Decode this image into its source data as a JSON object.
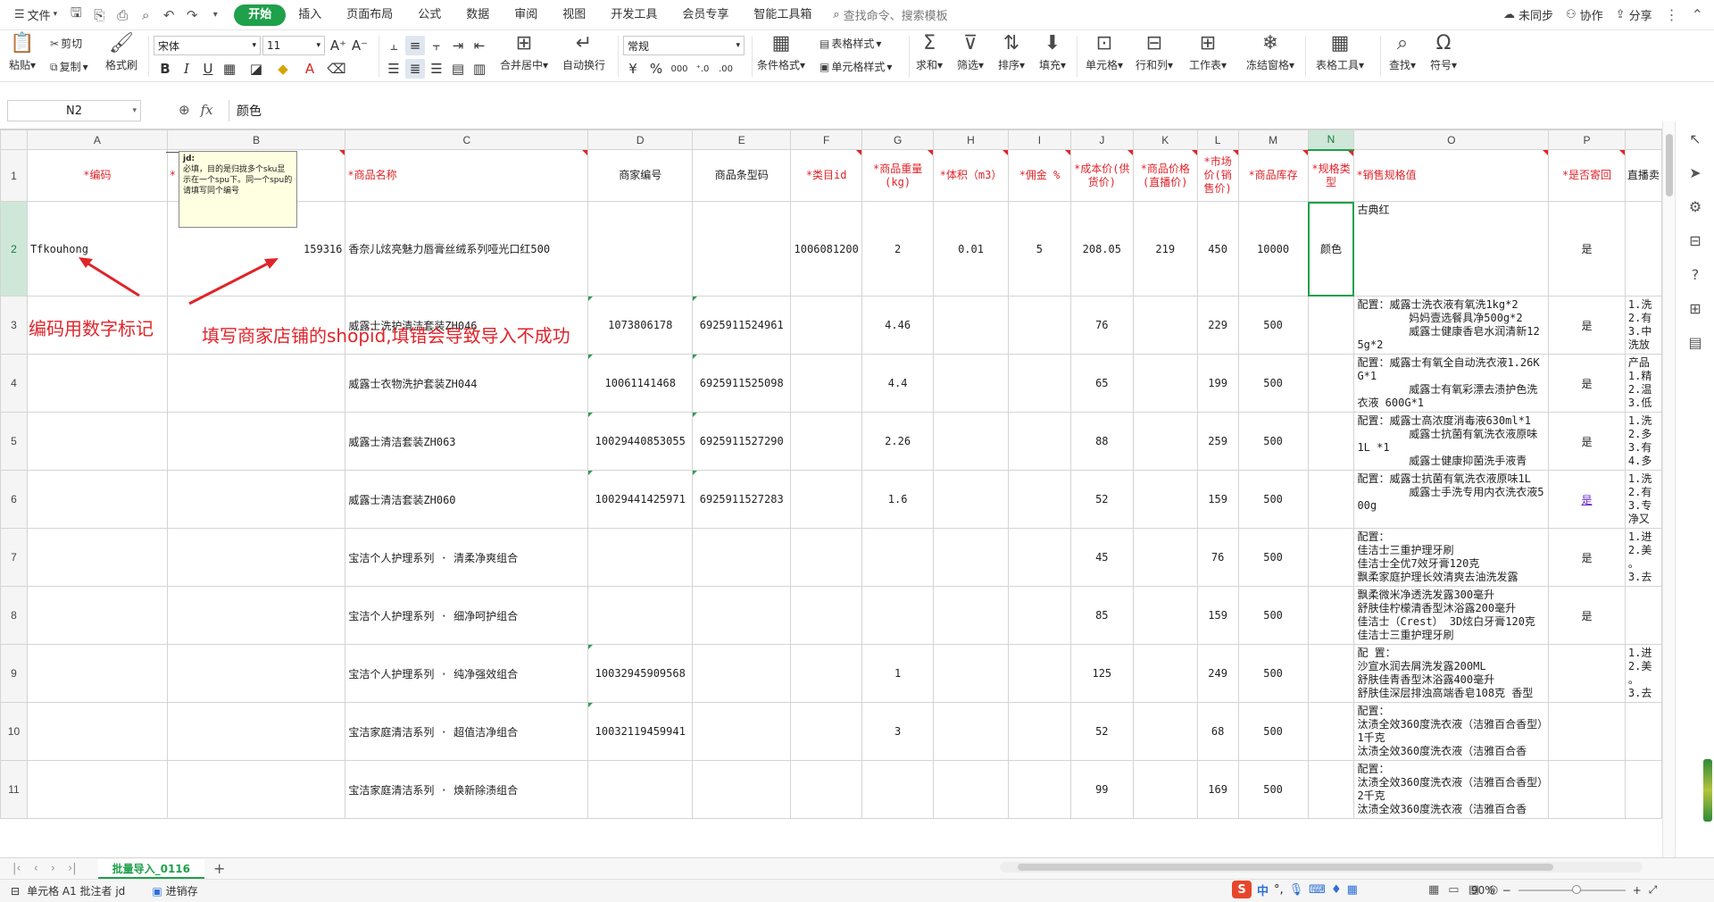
{
  "titlebar": {
    "file_label": "文件",
    "menu_tabs": [
      "开始",
      "插入",
      "页面布局",
      "公式",
      "数据",
      "审阅",
      "视图",
      "开发工具",
      "会员专享",
      "智能工具箱"
    ],
    "search_placeholder": "查找命令、搜索模板",
    "unsynced": "未同步",
    "collab": "协作",
    "share": "分享"
  },
  "ribbon": {
    "paste": "粘贴",
    "cut": "剪切",
    "copy": "复制",
    "format_painter": "格式刷",
    "font_name": "宋体",
    "font_size": "11",
    "merge_center": "合并居中",
    "wrap_text": "自动换行",
    "number_format": "常规",
    "cond_format": "条件格式",
    "table_style": "表格样式",
    "cell_style": "单元格样式",
    "sum": "求和",
    "filter": "筛选",
    "sort": "排序",
    "fill": "填充",
    "cell": "单元格",
    "row_col": "行和列",
    "worksheet": "工作表",
    "freeze": "冻结窗格",
    "table_tools": "表格工具",
    "find": "查找",
    "symbol": "符号"
  },
  "formula_bar": {
    "cell_ref": "N2",
    "value": "颜色"
  },
  "columns": [
    "A",
    "B",
    "C",
    "D",
    "E",
    "F",
    "G",
    "H",
    "I",
    "J",
    "K",
    "L",
    "M",
    "N",
    "O",
    "P"
  ],
  "header_row": {
    "A": "*编码",
    "B": "*",
    "C": "*商品名称",
    "D": "商家编号",
    "E": "商品条型码",
    "F": "*类目id",
    "G": "*商品重量(kg)",
    "H": "*体积（m3）",
    "I": "*佣金 %",
    "J": "*成本价(供货价)",
    "K": "*商品价格(直播价)",
    "L": "*市场价(销售价)",
    "M": "*商品库存",
    "N": "*规格类型",
    "O": "*销售规格值",
    "P": "*是否寄回",
    "Q": "直播卖"
  },
  "rows": [
    {
      "num": "2",
      "A": "Tfkouhong",
      "B": "159316",
      "C": "香奈儿炫亮魅力唇膏丝绒系列哑光口红500",
      "D": "",
      "E": "",
      "F": "1006081200",
      "G": "2",
      "H": "0.01",
      "I": "5",
      "J": "208.05",
      "K": "219",
      "L": "450",
      "M": "10000",
      "N": "颜色",
      "O": "古典红",
      "P": "是",
      "Q": ""
    },
    {
      "num": "3",
      "A": "",
      "B": "",
      "C": "威露士洗护清洁套装ZH046",
      "D": "1073806178",
      "E": "6925911524961",
      "F": "",
      "G": "4.46",
      "H": "",
      "I": "",
      "J": "76",
      "K": "",
      "L": "229",
      "M": "500",
      "N": "",
      "O": "配置：威露士洗衣液有氧洗1kg*2\n        妈妈壹选餐具净500g*2\n        威露士健康香皂水润清新125g*2",
      "P": "是",
      "Q": "1.洗\n2.有\n3.中\n洗放"
    },
    {
      "num": "4",
      "A": "",
      "B": "",
      "C": "威露士衣物洗护套装ZH044",
      "D": "10061141468",
      "E": "6925911525098",
      "F": "",
      "G": "4.4",
      "H": "",
      "I": "",
      "J": "65",
      "K": "",
      "L": "199",
      "M": "500",
      "N": "",
      "O": "配置：威露士有氧全自动洗衣液1.26KG*1\n        威露士有氧彩漂去渍护色洗衣液 600G*1",
      "P": "是",
      "Q": "产品\n1.精\n2.温\n3.低"
    },
    {
      "num": "5",
      "A": "",
      "B": "",
      "C": "威露士清洁套装ZH063",
      "D": "10029440853055",
      "E": "6925911527290",
      "F": "",
      "G": "2.26",
      "H": "",
      "I": "",
      "J": "88",
      "K": "",
      "L": "259",
      "M": "500",
      "N": "",
      "O": "配置：威露士高浓度消毒液630ml*1\n        威露士抗菌有氧洗衣液原味 1L *1\n        威露士健康抑菌洗手液青",
      "P": "是",
      "Q": "1.洗\n2.多\n3.有\n4.多"
    },
    {
      "num": "6",
      "A": "",
      "B": "",
      "C": "威露士清洁套装ZH060",
      "D": "10029441425971",
      "E": "6925911527283",
      "F": "",
      "G": "1.6",
      "H": "",
      "I": "",
      "J": "52",
      "K": "",
      "L": "159",
      "M": "500",
      "N": "",
      "O": "配置：威露士抗菌有氧洗衣液原味1L\n        威露士手洗专用内衣洗衣液500g",
      "P": "是",
      "Q": "1.洗\n2.有\n3.专\n净又"
    },
    {
      "num": "7",
      "A": "",
      "B": "",
      "C": "宝洁个人护理系列 · 清柔净爽组合",
      "D": "",
      "E": "",
      "F": "",
      "G": "",
      "H": "",
      "I": "",
      "J": "45",
      "K": "",
      "L": "76",
      "M": "500",
      "N": "",
      "O": "配置：\n佳洁士三重护理牙刷\n佳洁士全优7效牙膏120克\n飘柔家庭护理长效清爽去油洗发露",
      "P": "是",
      "Q": "1.进\n2.美\n。\n3.去"
    },
    {
      "num": "8",
      "A": "",
      "B": "",
      "C": "宝洁个人护理系列 · 细净呵护组合",
      "D": "",
      "E": "",
      "F": "",
      "G": "",
      "H": "",
      "I": "",
      "J": "85",
      "K": "",
      "L": "159",
      "M": "500",
      "N": "",
      "O": "飘柔微米净透洗发露300毫升\n舒肤佳柠檬清香型沐浴露200毫升\n佳洁士（Crest） 3D炫白牙膏120克\n佳洁士三重护理牙刷",
      "P": "是",
      "Q": ""
    },
    {
      "num": "9",
      "A": "",
      "B": "",
      "C": "宝洁个人护理系列 · 纯净强效组合",
      "D": "10032945909568",
      "E": "",
      "F": "",
      "G": "1",
      "H": "",
      "I": "",
      "J": "125",
      "K": "",
      "L": "249",
      "M": "500",
      "N": "",
      "O": "配 置：\n沙宣水润去屑洗发露200ML\n舒肤佳青香型沐浴露400毫升\n舒肤佳深层排浊高端香皂108克 香型",
      "P": "",
      "Q": "1.进\n2.美\n。\n3.去"
    },
    {
      "num": "10",
      "A": "",
      "B": "",
      "C": "宝洁家庭清洁系列 · 超值洁净组合",
      "D": "10032119459941",
      "E": "",
      "F": "",
      "G": "3",
      "H": "",
      "I": "",
      "J": "52",
      "K": "",
      "L": "68",
      "M": "500",
      "N": "",
      "O": "配置：\n汰渍全效360度洗衣液（洁雅百合香型）1千克\n汰渍全效360度洗衣液（洁雅百合香",
      "P": "",
      "Q": ""
    },
    {
      "num": "11",
      "A": "",
      "B": "",
      "C": "宝洁家庭清洁系列 · 焕新除渍组合",
      "D": "",
      "E": "",
      "F": "",
      "G": "",
      "H": "",
      "I": "",
      "J": "99",
      "K": "",
      "L": "169",
      "M": "500",
      "N": "",
      "O": "配置：\n汰渍全效360度洗衣液（洁雅百合香型）2千克\n汰渍全效360度洗衣液（洁雅百合香",
      "P": "",
      "Q": ""
    }
  ],
  "comment": {
    "author": "jd:",
    "text": "必填，目的是归拢多个sku显示在一个spu下。同一个spu的请填写同个编号"
  },
  "annotations": {
    "a": "编码用数字标记",
    "b": "填写商家店铺的shopid,填错会导致导入不成功"
  },
  "sheet_tab": "批量导入_0116",
  "status": {
    "cell_info": "单元格 A1 批注者 jd",
    "inventory": "进销存",
    "zoom": "90%"
  },
  "ime": {
    "logo": "S",
    "label": "中"
  }
}
